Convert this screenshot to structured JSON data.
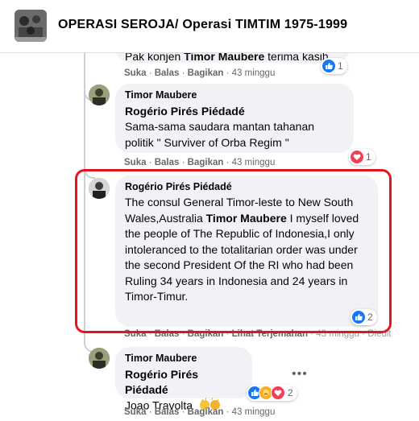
{
  "group": {
    "title": "OPERASI SEROJA/ Operasi TIMTIM 1975-1999"
  },
  "comments": [
    {
      "text_partial_before": "Pak konjen ",
      "text_partial_bold": "Timor Maubere",
      "text_partial_after": " terima kasih.",
      "actions": {
        "like": "Suka",
        "reply": "Balas",
        "share": "Bagikan",
        "time": "43 minggu"
      },
      "reaction": {
        "icon": "like-icon",
        "count": "1"
      }
    },
    {
      "author": "Timor Maubere",
      "mention": "Rogério Pirés Piédadé",
      "text": "Sama-sama saudara mantan tahanan politik \" Surviver of Orba Regim \"",
      "actions": {
        "like": "Suka",
        "reply": "Balas",
        "share": "Bagikan",
        "time": "43 minggu"
      },
      "reaction": {
        "icon": "love-icon",
        "count": "1"
      }
    },
    {
      "author": "Rogério Pirés Piédadé",
      "text_a": "The consul General Timor-leste to New South Wales,Australia ",
      "text_bold": "Timor Maubere",
      "text_b": " I myself loved the people of The Republic of Indonesia,I only intoleranced to the totalitarian order was under the second President Of the RI who had been Ruling 34 years in Indonesia and 24 years in Timor-Timur.",
      "actions": {
        "like": "Suka",
        "reply": "Balas",
        "share": "Bagikan",
        "translation": "Lihat Terjemahan",
        "time": "43 minggu",
        "edited": "Diedit"
      },
      "reaction": {
        "icon": "like-icon",
        "count": "2"
      }
    },
    {
      "author": "Timor Maubere",
      "mention": "Rogério Pirés Piédadé",
      "text": "Joao Travolta",
      "emoji": "clapping-hands",
      "actions": {
        "like": "Suka",
        "reply": "Balas",
        "share": "Bagikan",
        "time": "43 minggu"
      },
      "reaction": {
        "icon": "like-care-love-icons",
        "count": "2"
      },
      "more": "•••"
    }
  ],
  "colors": {
    "highlight": "#e3161d",
    "like": "#1877f2",
    "love": "#f33e58",
    "care": "#f7b125"
  }
}
